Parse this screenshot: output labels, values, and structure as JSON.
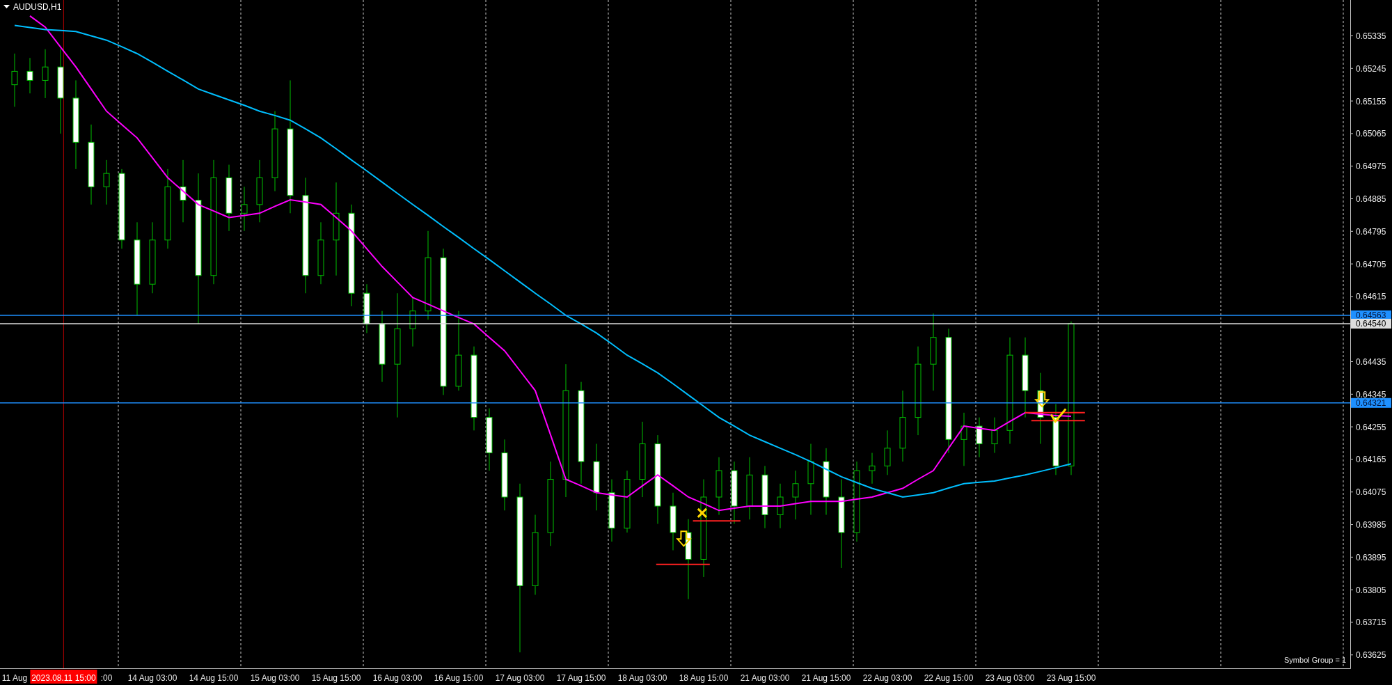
{
  "chart": {
    "chart_data": {
      "type": "candlestick",
      "title": "AUDUSD,H1",
      "categories": [
        "11 Aug",
        null,
        null,
        null,
        null,
        null,
        ":00",
        null,
        null,
        "14 Aug 03:00",
        null,
        null,
        null,
        "14 Aug 15:00",
        null,
        null,
        null,
        "15 Aug 03:00",
        null,
        null,
        null,
        "15 Aug 15:00",
        null,
        null,
        null,
        "16 Aug 03:00",
        null,
        null,
        null,
        "16 Aug 15:00",
        null,
        null,
        null,
        "17 Aug 03:00",
        null,
        null,
        null,
        "17 Aug 15:00",
        null,
        null,
        null,
        "18 Aug 03:00",
        null,
        null,
        null,
        "18 Aug 15:00",
        null,
        null,
        null,
        "21 Aug 03:00",
        null,
        null,
        null,
        "21 Aug 15:00",
        null,
        null,
        null,
        "22 Aug 03:00",
        null,
        null,
        null,
        "22 Aug 15:00",
        null,
        null,
        null,
        "23 Aug 03:00",
        null,
        null,
        null,
        "23 Aug 15:00",
        null,
        null,
        null,
        null,
        null,
        null,
        null,
        null,
        null,
        null,
        null,
        null,
        null,
        null,
        null,
        null,
        null,
        null
      ],
      "ohlc": [
        [
          0.652,
          0.65286,
          0.65139,
          0.65237
        ],
        [
          0.65237,
          0.65274,
          0.65176,
          0.65212
        ],
        [
          0.65212,
          0.65298,
          0.65163,
          0.65249
        ],
        [
          0.65249,
          0.65298,
          0.65065,
          0.65163
        ],
        [
          0.65163,
          0.65212,
          0.64967,
          0.65041
        ],
        [
          0.65041,
          0.6509,
          0.64869,
          0.64918
        ],
        [
          0.64918,
          0.64992,
          0.64869,
          0.64955
        ],
        [
          0.64955,
          0.64967,
          0.64747,
          0.64771
        ],
        [
          0.64771,
          0.6482,
          0.64563,
          0.64649
        ],
        [
          0.64649,
          0.6482,
          0.64624,
          0.64771
        ],
        [
          0.64771,
          0.64967,
          0.64747,
          0.64918
        ],
        [
          0.64918,
          0.64992,
          0.6482,
          0.64881
        ],
        [
          0.64881,
          0.64955,
          0.64539,
          0.64673
        ],
        [
          0.64673,
          0.64992,
          0.64649,
          0.64943
        ],
        [
          0.64943,
          0.64979,
          0.64796,
          0.64845
        ],
        [
          0.64845,
          0.64918,
          0.64796,
          0.64869
        ],
        [
          0.64869,
          0.64992,
          0.6482,
          0.64943
        ],
        [
          0.64943,
          0.65127,
          0.64906,
          0.65078
        ],
        [
          0.65078,
          0.65212,
          0.64845,
          0.64894
        ],
        [
          0.64894,
          0.64943,
          0.64624,
          0.64673
        ],
        [
          0.64673,
          0.6482,
          0.64649,
          0.64771
        ],
        [
          0.64771,
          0.6493,
          0.64673,
          0.64845
        ],
        [
          0.64845,
          0.64869,
          0.64588,
          0.64624
        ],
        [
          0.64624,
          0.64649,
          0.64514,
          0.64539
        ],
        [
          0.64539,
          0.64575,
          0.64379,
          0.64428
        ],
        [
          0.64428,
          0.64624,
          0.64281,
          0.64526
        ],
        [
          0.64526,
          0.64612,
          0.64477,
          0.64575
        ],
        [
          0.64575,
          0.64796,
          0.64551,
          0.64722
        ],
        [
          0.64722,
          0.64747,
          0.64343,
          0.64367
        ],
        [
          0.64367,
          0.64575,
          0.64355,
          0.64453
        ],
        [
          0.64453,
          0.64477,
          0.64245,
          0.64281
        ],
        [
          0.64281,
          0.64306,
          0.64134,
          0.64183
        ],
        [
          0.64183,
          0.6422,
          0.64024,
          0.64061
        ],
        [
          0.64061,
          0.64098,
          0.63632,
          0.63816
        ],
        [
          0.63816,
          0.64012,
          0.63791,
          0.63963
        ],
        [
          0.63963,
          0.64159,
          0.63926,
          0.6411
        ],
        [
          0.6411,
          0.64428,
          0.64061,
          0.64355
        ],
        [
          0.64355,
          0.64379,
          0.64098,
          0.64159
        ],
        [
          0.64159,
          0.64208,
          0.64024,
          0.64073
        ],
        [
          0.64073,
          0.6411,
          0.63938,
          0.63975
        ],
        [
          0.63975,
          0.64134,
          0.63963,
          0.6411
        ],
        [
          0.6411,
          0.64269,
          0.64061,
          0.64208
        ],
        [
          0.64208,
          0.64232,
          0.63987,
          0.64036
        ],
        [
          0.64036,
          0.64073,
          0.63914,
          0.63963
        ],
        [
          0.63963,
          0.64,
          0.63779,
          0.63889
        ],
        [
          0.63889,
          0.6411,
          0.6384,
          0.64061
        ],
        [
          0.64061,
          0.64171,
          0.64012,
          0.64134
        ],
        [
          0.64134,
          0.64159,
          0.63987,
          0.64036
        ],
        [
          0.64036,
          0.64171,
          0.63999,
          0.64122
        ],
        [
          0.64122,
          0.64147,
          0.63975,
          0.64012
        ],
        [
          0.64012,
          0.64098,
          0.63975,
          0.64061
        ],
        [
          0.64061,
          0.64134,
          0.63999,
          0.64098
        ],
        [
          0.64098,
          0.64208,
          0.64012,
          0.64159
        ],
        [
          0.64159,
          0.64196,
          0.64012,
          0.64061
        ],
        [
          0.64061,
          0.6411,
          0.63865,
          0.63963
        ],
        [
          0.63963,
          0.64159,
          0.63938,
          0.64134
        ],
        [
          0.64134,
          0.64183,
          0.64098,
          0.64147
        ],
        [
          0.64147,
          0.64245,
          0.64122,
          0.64196
        ],
        [
          0.64196,
          0.64355,
          0.64159,
          0.64281
        ],
        [
          0.64281,
          0.64477,
          0.64232,
          0.64428
        ],
        [
          0.64428,
          0.64568,
          0.64355,
          0.64502
        ],
        [
          0.64502,
          0.64526,
          0.64183,
          0.6422
        ],
        [
          0.6422,
          0.64294,
          0.64147,
          0.64257
        ],
        [
          0.64257,
          0.64281,
          0.64171,
          0.64208
        ],
        [
          0.64208,
          0.64281,
          0.64183,
          0.64245
        ],
        [
          0.64245,
          0.64502,
          0.64208,
          0.64453
        ],
        [
          0.64453,
          0.64502,
          0.64281,
          0.64355
        ],
        [
          0.64355,
          0.64404,
          0.64208,
          0.64281
        ],
        [
          0.64281,
          0.64318,
          0.64122,
          0.64147
        ],
        [
          0.64147,
          0.64546,
          0.64122,
          0.6454
        ],
        null,
        null,
        null,
        null,
        null,
        null,
        null,
        null,
        null,
        null,
        null,
        null,
        null,
        null,
        null,
        null,
        null,
        null
      ],
      "series": [
        {
          "type": "line",
          "color": "#ff00ff",
          "values": [
            null,
            0.6539,
            0.65359,
            0.65304,
            0.65249,
            0.65188,
            0.65127,
            0.6509,
            0.65053,
            0.64998,
            0.64943,
            0.64906,
            0.64869,
            0.64851,
            0.64833,
            0.64839,
            0.64845,
            0.64864,
            0.64882,
            0.64876,
            0.64869,
            0.64833,
            0.64796,
            0.64747,
            0.64698,
            0.64655,
            0.64612,
            0.64594,
            0.64575,
            0.64557,
            0.64539,
            0.64502,
            0.64465,
            0.6441,
            0.64355,
            0.64233,
            0.6411,
            0.64092,
            0.64073,
            0.64067,
            0.64061,
            0.64092,
            0.64122,
            0.64092,
            0.64061,
            0.64043,
            0.64024,
            0.6403,
            0.64036,
            0.64036,
            0.64036,
            0.64043,
            0.64049,
            0.64049,
            0.64049,
            0.64055,
            0.64061,
            0.64073,
            0.64085,
            0.6411,
            0.64134,
            0.64196,
            0.64257,
            0.64251,
            0.64245,
            0.6427,
            0.64294,
            0.6429,
            0.64286,
            0.64284,
            null,
            null,
            null,
            null,
            null,
            null,
            null,
            null,
            null,
            null,
            null,
            null,
            null,
            null,
            null,
            null,
            null,
            null
          ]
        },
        {
          "type": "line",
          "color": "#00bfff",
          "values": [
            0.65364,
            0.65358,
            0.65352,
            0.6535,
            0.65347,
            0.65335,
            0.65323,
            0.65305,
            0.65286,
            0.65262,
            0.65237,
            0.65213,
            0.65188,
            0.65173,
            0.65158,
            0.65143,
            0.65127,
            0.65115,
            0.65102,
            0.65078,
            0.65053,
            0.65023,
            0.64992,
            0.64962,
            0.64931,
            0.649,
            0.64869,
            0.64839,
            0.64808,
            0.64778,
            0.64747,
            0.64717,
            0.64686,
            0.64655,
            0.64624,
            0.64594,
            0.64563,
            0.64539,
            0.64514,
            0.64484,
            0.64453,
            0.64429,
            0.64404,
            0.64374,
            0.64343,
            0.64312,
            0.64281,
            0.64257,
            0.64232,
            0.64214,
            0.64196,
            0.64178,
            0.64159,
            0.64138,
            0.64117,
            0.64101,
            0.64085,
            0.64073,
            0.64061,
            0.64067,
            0.64073,
            0.64086,
            0.64098,
            0.64102,
            0.64105,
            0.64114,
            0.64122,
            0.64132,
            0.64142,
            0.64153,
            null,
            null,
            null,
            null,
            null,
            null,
            null,
            null,
            null,
            null,
            null,
            null,
            null,
            null,
            null,
            null,
            null,
            null
          ]
        }
      ],
      "ylim": [
        0.63588,
        0.65434
      ],
      "yticks": [
        0.65335,
        0.65245,
        0.65155,
        0.65065,
        0.64975,
        0.64885,
        0.64795,
        0.64705,
        0.64615,
        0.64435,
        0.64345,
        0.64255,
        0.64165,
        0.64075,
        0.63985,
        0.63895,
        0.63805,
        0.63715,
        0.63625
      ],
      "ref_lines": [
        {
          "axis": "y",
          "value": 0.64563,
          "label": "0.64563",
          "color": "#1e90ff"
        },
        {
          "axis": "y",
          "value": 0.6454,
          "label": "0.64540",
          "color": "#dcdcdc"
        },
        {
          "axis": "y",
          "value": 0.64321,
          "label": "0.64321",
          "color": "#1e90ff"
        }
      ]
    },
    "crosshair": {
      "label": "2023.08.11 15:00"
    },
    "symbol_group": "Symbol Group = 1"
  }
}
